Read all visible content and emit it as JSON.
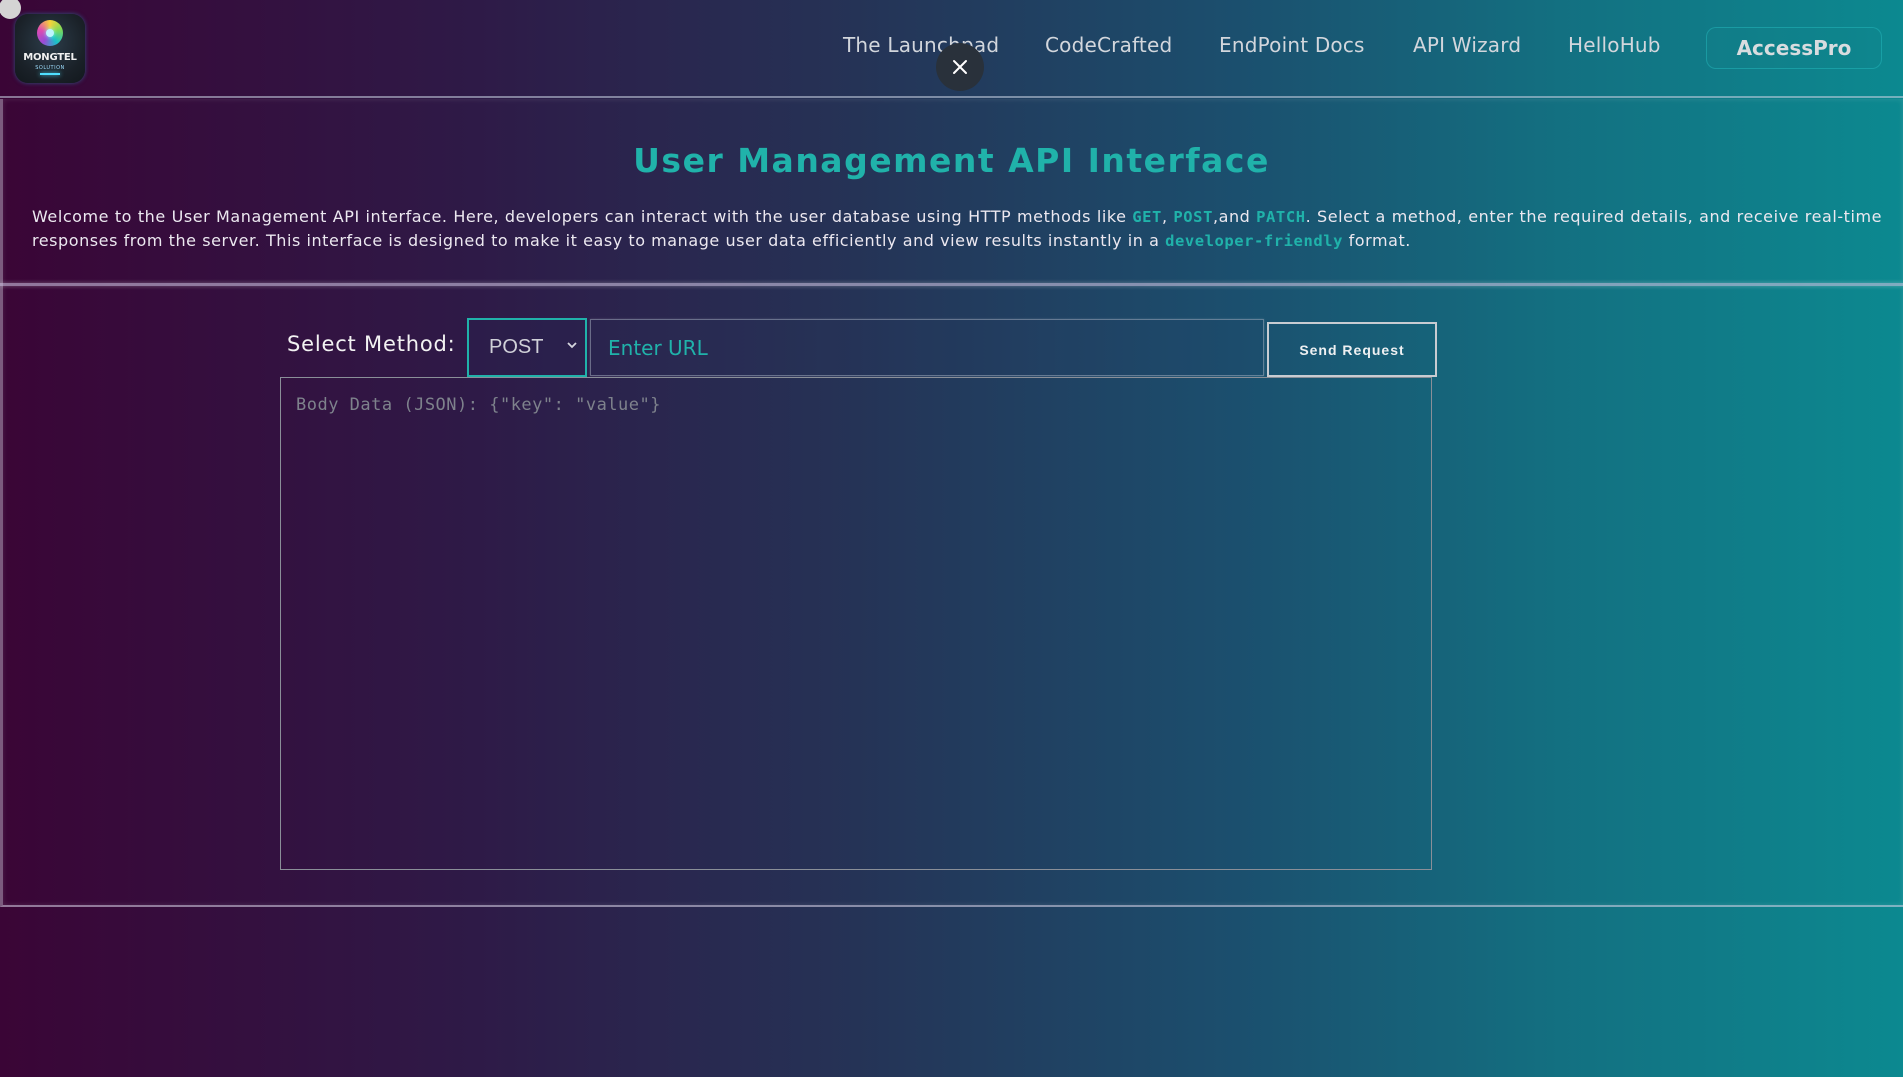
{
  "app": {
    "logo": {
      "name": "MONGTEL",
      "subtitle": "SOLUTION"
    }
  },
  "nav": {
    "items": [
      {
        "label": "The Launchpad"
      },
      {
        "label": "CodeCrafted"
      },
      {
        "label": "EndPoint Docs"
      },
      {
        "label": "API Wizard"
      },
      {
        "label": "HelloHub"
      },
      {
        "label": "AccessPro"
      }
    ],
    "close_icon": "close-icon"
  },
  "intro": {
    "title": "User Management API Interface",
    "desc_1": "Welcome to the User Management API interface. Here, developers can interact with the user database using HTTP methods like ",
    "hl_get": "GET",
    "sep_1": ", ",
    "hl_post": "POST",
    "sep_2": ",and ",
    "hl_patch": "PATCH",
    "desc_2": ". Select a method, enter the required details, and receive real-time responses from the server. This interface is designed to make it easy to manage user data efficiently and view results instantly in a ",
    "hl_friendly": "developer-friendly",
    "desc_3": " format."
  },
  "form": {
    "method_label": "Select Method:",
    "method_selected": "POST",
    "url_value": "",
    "url_placeholder": "Enter URL",
    "send_label": "Send Request",
    "body_value": "",
    "body_placeholder": "Body Data (JSON): {\"key\": \"value\"}"
  },
  "colors": {
    "accent": "#20b2aa",
    "gradient_left": "#3a0536",
    "gradient_right": "#0c8990"
  }
}
